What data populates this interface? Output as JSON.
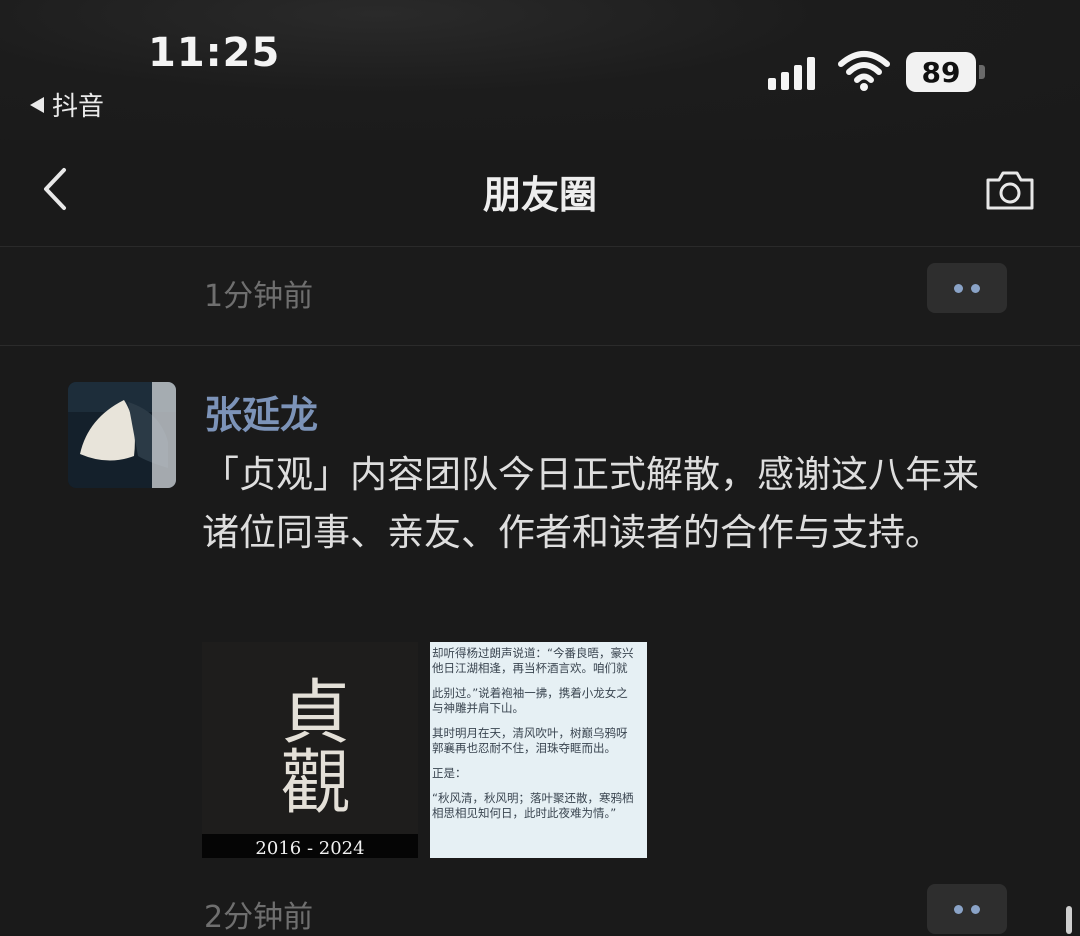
{
  "status_bar": {
    "time": "11:25",
    "back_app_label": "抖音",
    "battery_level": "89",
    "icons": [
      "signal-icon",
      "wifi-icon",
      "battery-icon"
    ]
  },
  "nav": {
    "title": "朋友圈",
    "back_icon": "chevron-left-icon",
    "camera_icon": "camera-icon"
  },
  "previous_post": {
    "time_ago": "1分钟前"
  },
  "post": {
    "author": "张延龙",
    "text": "「贞观」内容团队今日正式解散，感谢这八年来诸位同事、亲友、作者和读者的合作与支持。",
    "image1": {
      "calligraphy": "貞觀",
      "years": "2016 - 2024"
    },
    "image2": {
      "lines": [
        "却听得杨过朗声说道：“今番良晤，豪兴",
        "他日江湖相逢，再当杯酒言欢。咱们就",
        "",
        "此别过。”说着袍袖一拂，携着小龙女之",
        "与神雕并肩下山。",
        "",
        "其时明月在天，清风吹叶，树巅乌鸦呀",
        "郭襄再也忍耐不住，泪珠夺眶而出。",
        "",
        "正是：",
        "",
        "“秋风清，秋风明；落叶聚还散，寒鸦栖",
        "相思相见知何日，此时此夜难为情。”"
      ]
    },
    "time_ago": "2分钟前"
  },
  "colors": {
    "background": "#191919",
    "author_name": "#7c93b8",
    "more_dots": "#8aa3c7",
    "muted_text": "#6f6f6f"
  }
}
